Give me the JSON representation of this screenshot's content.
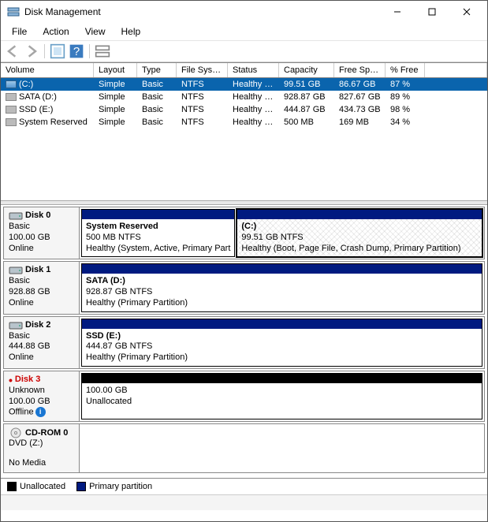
{
  "window": {
    "title": "Disk Management"
  },
  "menu": {
    "file": "File",
    "action": "Action",
    "view": "View",
    "help": "Help"
  },
  "columns": {
    "volume": "Volume",
    "layout": "Layout",
    "type": "Type",
    "filesystem": "File System",
    "status": "Status",
    "capacity": "Capacity",
    "freespace": "Free Spa...",
    "pctfree": "% Free"
  },
  "volumes": [
    {
      "name": "(C:)",
      "layout": "Simple",
      "type": "Basic",
      "fs": "NTFS",
      "status": "Healthy (B...",
      "capacity": "99.51 GB",
      "free": "86.67 GB",
      "pct": "87 %",
      "selected": true,
      "icon": "drive"
    },
    {
      "name": "SATA (D:)",
      "layout": "Simple",
      "type": "Basic",
      "fs": "NTFS",
      "status": "Healthy (P...",
      "capacity": "928.87 GB",
      "free": "827.67 GB",
      "pct": "89 %",
      "selected": false,
      "icon": "simple"
    },
    {
      "name": "SSD (E:)",
      "layout": "Simple",
      "type": "Basic",
      "fs": "NTFS",
      "status": "Healthy (P...",
      "capacity": "444.87 GB",
      "free": "434.73 GB",
      "pct": "98 %",
      "selected": false,
      "icon": "simple"
    },
    {
      "name": "System Reserved",
      "layout": "Simple",
      "type": "Basic",
      "fs": "NTFS",
      "status": "Healthy (S...",
      "capacity": "500 MB",
      "free": "169 MB",
      "pct": "34 %",
      "selected": false,
      "icon": "simple"
    }
  ],
  "disks": {
    "d0": {
      "name": "Disk 0",
      "type": "Basic",
      "size": "100.00 GB",
      "status": "Online",
      "p0": {
        "title": "System Reserved",
        "sub": "500 MB NTFS",
        "health": "Healthy (System, Active, Primary Part"
      },
      "p1": {
        "title": "(C:)",
        "sub": "99.51 GB NTFS",
        "health": "Healthy (Boot, Page File, Crash Dump, Primary Partition)"
      }
    },
    "d1": {
      "name": "Disk 1",
      "type": "Basic",
      "size": "928.88 GB",
      "status": "Online",
      "p0": {
        "title": "SATA  (D:)",
        "sub": "928.87 GB NTFS",
        "health": "Healthy (Primary Partition)"
      }
    },
    "d2": {
      "name": "Disk 2",
      "type": "Basic",
      "size": "444.88 GB",
      "status": "Online",
      "p0": {
        "title": "SSD  (E:)",
        "sub": "444.87 GB NTFS",
        "health": "Healthy (Primary Partition)"
      }
    },
    "d3": {
      "name": "Disk 3",
      "type": "Unknown",
      "size": "100.00 GB",
      "status": "Offline",
      "p0": {
        "title": "",
        "sub": "100.00 GB",
        "health": "Unallocated"
      }
    },
    "cd": {
      "name": "CD-ROM 0",
      "type": "DVD (Z:)",
      "size": "",
      "status": "No Media"
    }
  },
  "legend": {
    "unallocated": "Unallocated",
    "primary": "Primary partition"
  }
}
